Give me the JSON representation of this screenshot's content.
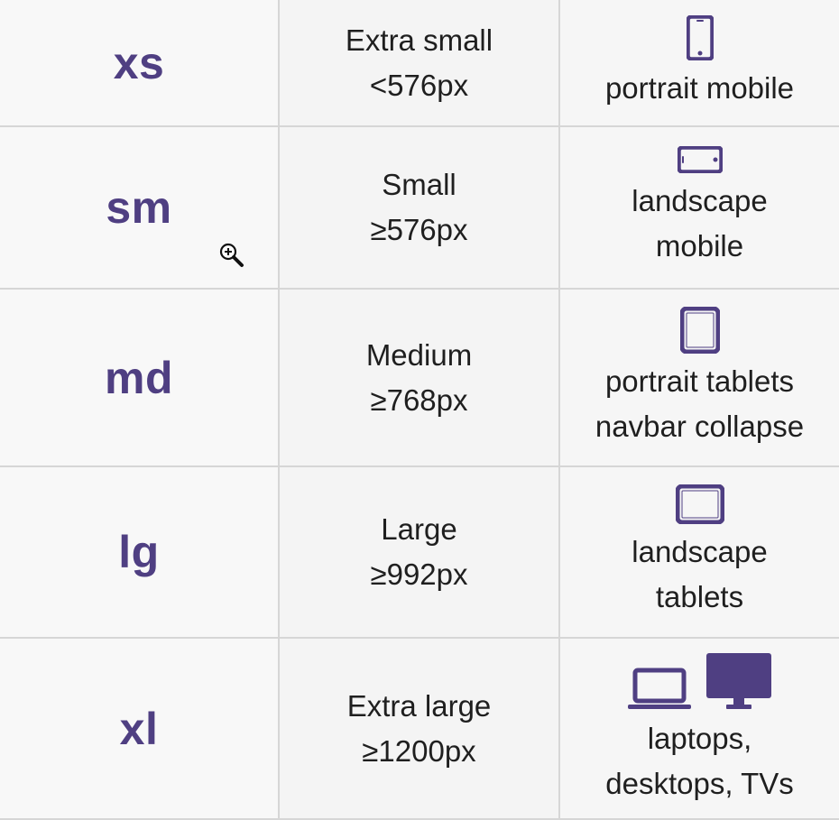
{
  "colors": {
    "accent": "#4f3f82",
    "text": "#1f1f1f",
    "grid": "#d6d6d6"
  },
  "rows": [
    {
      "code": "xs",
      "size_name": "Extra small",
      "size_range": "<576px",
      "device_line1": "portrait mobile",
      "device_line2": "",
      "note": "",
      "icons": [
        "phone-portrait-icon"
      ]
    },
    {
      "code": "sm",
      "size_name": "Small",
      "size_range": "≥576px",
      "device_line1": "landscape",
      "device_line2": "mobile",
      "note": "",
      "icons": [
        "phone-landscape-icon"
      ]
    },
    {
      "code": "md",
      "size_name": "Medium",
      "size_range": "≥768px",
      "device_line1": "portrait tablets",
      "device_line2": "",
      "note": "navbar collapse",
      "icons": [
        "tablet-portrait-icon"
      ]
    },
    {
      "code": "lg",
      "size_name": "Large",
      "size_range": "≥992px",
      "device_line1": "landscape",
      "device_line2": "tablets",
      "note": "",
      "icons": [
        "tablet-landscape-icon"
      ]
    },
    {
      "code": "xl",
      "size_name": "Extra large",
      "size_range": "≥1200px",
      "device_line1": "laptops,",
      "device_line2": "desktops, TVs",
      "note": "",
      "icons": [
        "laptop-icon",
        "monitor-icon"
      ]
    }
  ],
  "cursor_icon": "zoom-in-cursor-icon"
}
